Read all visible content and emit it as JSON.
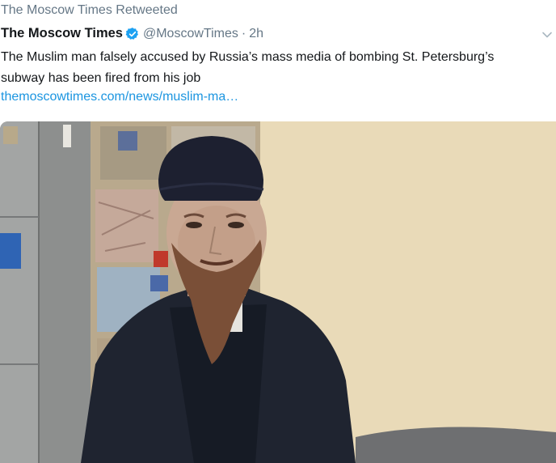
{
  "tweet": {
    "retweet_context": "The Moscow Times Retweeted",
    "author_name": "The Moscow Times",
    "handle": "@MoscowTimes",
    "separator": "·",
    "time": "2h",
    "text": "The Muslim man falsely accused by Russia’s mass media of bombing St. Petersburg’s subway has been fired from his job",
    "link": "themoscowtimes.com/news/muslim-ma…",
    "verified_icon": "verified-badge-icon",
    "caret_icon": "chevron-down-icon"
  },
  "colors": {
    "text": "#14171a",
    "secondary": "#657786",
    "link": "#1b95e0",
    "verified": "#1da1f2"
  }
}
